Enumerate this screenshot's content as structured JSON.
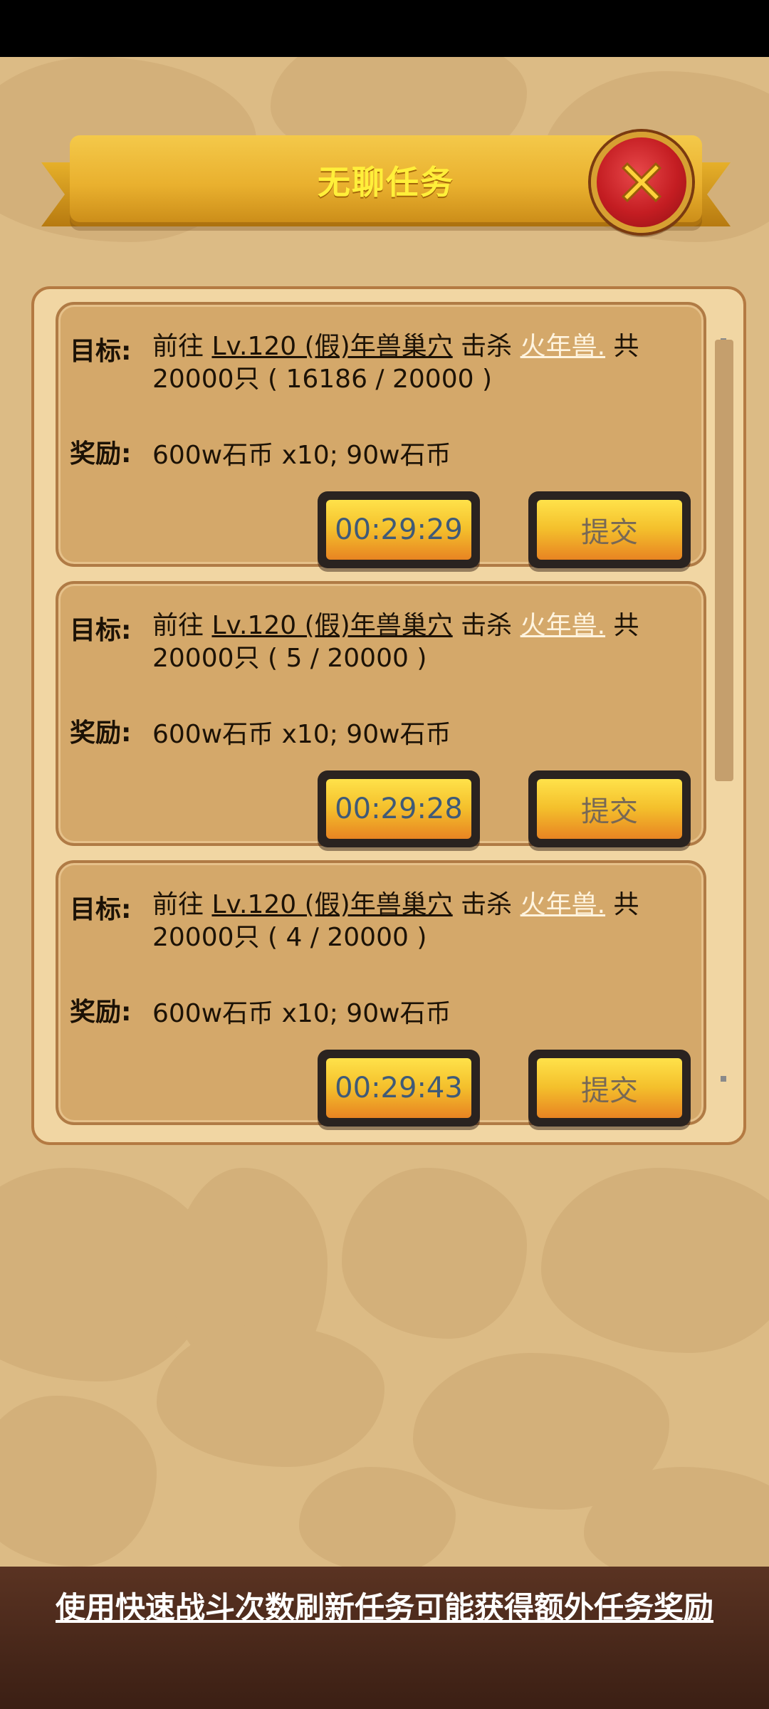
{
  "title": "无聊任务",
  "footer_text": "使用快速战斗次数刷新任务可能获得额外任务奖励",
  "labels": {
    "goal": "目标:",
    "reward": "奖励:"
  },
  "tasks": [
    {
      "goal_prefix": "前往 ",
      "location": "Lv.120 (假)年兽巢穴",
      "action": " 击杀 ",
      "monster": "火年兽.",
      "suffix": " 共",
      "count_line": "20000只 ( 16186 / 20000 )",
      "reward": "600w石币 x10; 90w石币",
      "timer": "00:29:29",
      "submit": "提交"
    },
    {
      "goal_prefix": "前往 ",
      "location": "Lv.120 (假)年兽巢穴",
      "action": " 击杀 ",
      "monster": "火年兽.",
      "suffix": " 共",
      "count_line": "20000只 ( 5 / 20000 )",
      "reward": "600w石币 x10; 90w石币",
      "timer": "00:29:28",
      "submit": "提交"
    },
    {
      "goal_prefix": "前往 ",
      "location": "Lv.120 (假)年兽巢穴",
      "action": " 击杀 ",
      "monster": "火年兽.",
      "suffix": " 共",
      "count_line": "20000只 ( 4 / 20000 )",
      "reward": "600w石币 x10; 90w石币",
      "timer": "00:29:43",
      "submit": "提交"
    }
  ],
  "icons": {
    "close": "close-icon"
  }
}
